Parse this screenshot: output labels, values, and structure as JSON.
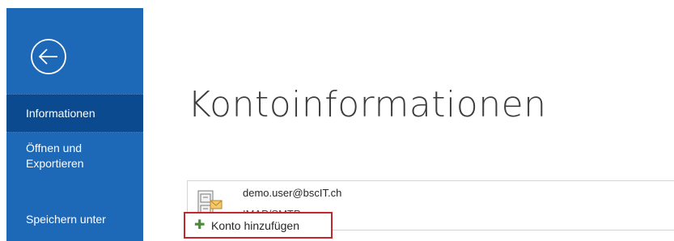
{
  "sidebar": {
    "back_icon": "back-arrow-circle-icon",
    "items": [
      {
        "label_line1": "Informationen",
        "label_line2": ""
      },
      {
        "label_line1": "Öffnen und",
        "label_line2": "Exportieren"
      },
      {
        "label_line1": "Speichern unter",
        "label_line2": ""
      }
    ]
  },
  "main": {
    "title": "Kontoinformationen",
    "account": {
      "email": "demo.user@bscIT.ch",
      "type": "IMAP/SMTP",
      "icon": "mail-account-icon"
    },
    "add_account": {
      "icon": "plus-icon",
      "label": "Konto hinzufügen"
    }
  },
  "colors": {
    "sidebar": "#1e68b8",
    "sidebar_selected": "#0b4a8f",
    "highlight_border": "#c1272d",
    "plus": "#4a8a3a"
  }
}
